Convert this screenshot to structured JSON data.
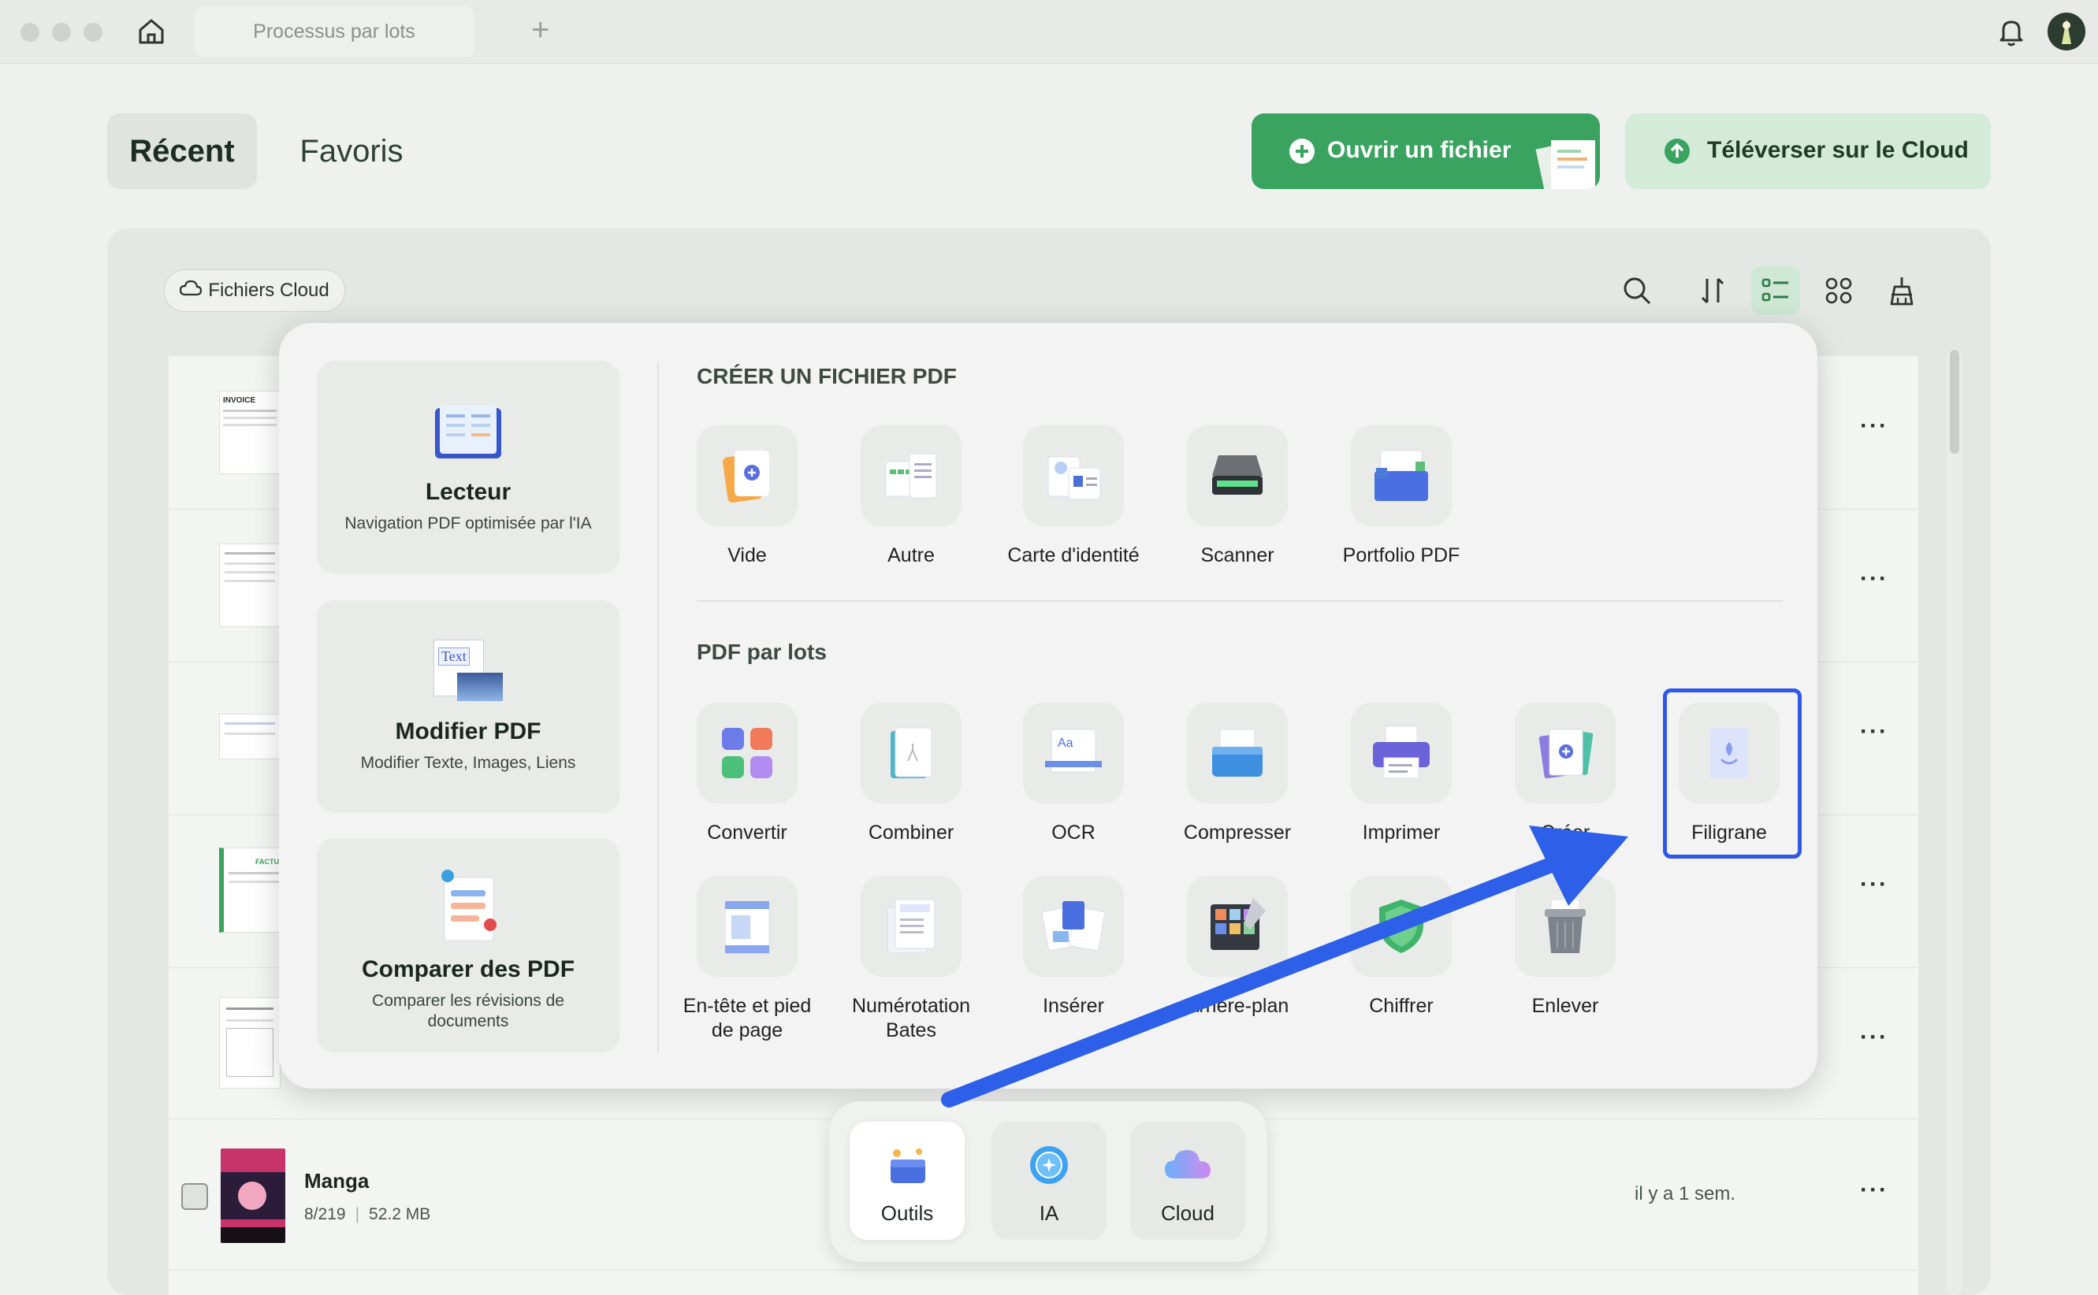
{
  "window": {
    "tab_title": "Processus par lots"
  },
  "nav": {
    "recent": "Récent",
    "favorites": "Favoris"
  },
  "actions": {
    "open_file": "Ouvrir un fichier",
    "upload_cloud": "Téléverser sur le Cloud"
  },
  "filter": {
    "cloud_files": "Fichiers Cloud"
  },
  "thumbnails": {
    "invoice_text": "INVOICE",
    "facture_text": "FACTURE"
  },
  "left_cards": [
    {
      "title": "Lecteur",
      "subtitle": "Navigation PDF optimisée par l'IA"
    },
    {
      "title": "Modifier PDF",
      "subtitle": "Modifier Texte, Images, Liens",
      "icon_text": "Text"
    },
    {
      "title": "Comparer des PDF",
      "subtitle": "Comparer les révisions de documents"
    }
  ],
  "create_section": {
    "title": "CRÉER UN FICHIER PDF",
    "tools": [
      "Vide",
      "Autre",
      "Carte d'identité",
      "Scanner",
      "Portfolio PDF"
    ]
  },
  "batch_section": {
    "title": "PDF par lots",
    "tools": [
      "Convertir",
      "Combiner",
      "OCR",
      "Compresser",
      "Imprimer",
      "Créer",
      "Filigrane",
      "En-tête et pied de page",
      "Numérotation Bates",
      "Insérer",
      "Arrière-plan",
      "Chiffrer",
      "Enlever"
    ]
  },
  "file_row": {
    "name": "Manga",
    "pages": "8/219",
    "size": "52.2 MB",
    "time": "il y a 1 sem."
  },
  "dock": {
    "tools": "Outils",
    "ai": "IA",
    "cloud": "Cloud"
  },
  "colors": {
    "accent_green": "#3aa35f",
    "highlight_blue": "#2f58e8",
    "arrow_blue": "#2d5fe8"
  }
}
